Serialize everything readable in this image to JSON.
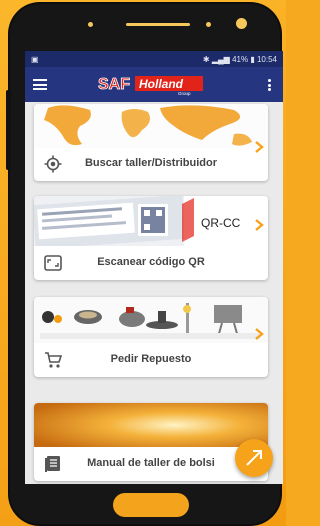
{
  "status_bar": {
    "battery_text": "41%",
    "time": "10:54"
  },
  "header": {
    "brand_primary": "SAF",
    "brand_secondary": "Holland",
    "brand_tag": "Group"
  },
  "cards": [
    {
      "label": "Buscar taller/Distribuidor",
      "icon": "location-target-icon"
    },
    {
      "label": "Escanear código QR",
      "icon": "scan-frame-icon",
      "image_text": "QR-CC"
    },
    {
      "label": "Pedir Repuesto",
      "icon": "shopping-cart-icon"
    },
    {
      "label": "Manual de taller de bolsi",
      "icon": "book-icon"
    }
  ],
  "fab": {
    "icon": "send-icon"
  },
  "colors": {
    "toolbar": "#26357f",
    "status_bar": "#1c2a6a",
    "accent": "#f6a21a",
    "brand_red": "#e2231a",
    "background": "#f6a91f"
  }
}
